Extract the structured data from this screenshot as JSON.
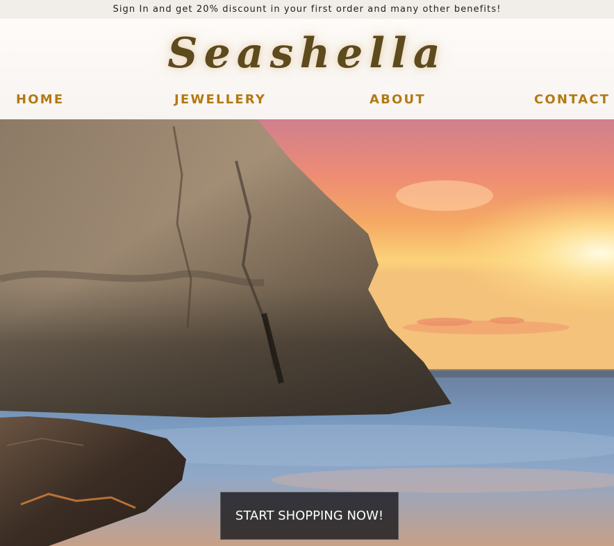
{
  "promo": {
    "text": "Sign In and get 20% discount in your first order and many other benefits!"
  },
  "brand": {
    "name": "Seashella",
    "color": "#5d4a1d"
  },
  "nav": {
    "items": [
      {
        "label": "HOME"
      },
      {
        "label": "JEWELLERY"
      },
      {
        "label": "ABOUT"
      },
      {
        "label": "CONTACT"
      }
    ],
    "color": "#b27a14"
  },
  "hero": {
    "cta_label": "START SHOPPING NOW!"
  }
}
